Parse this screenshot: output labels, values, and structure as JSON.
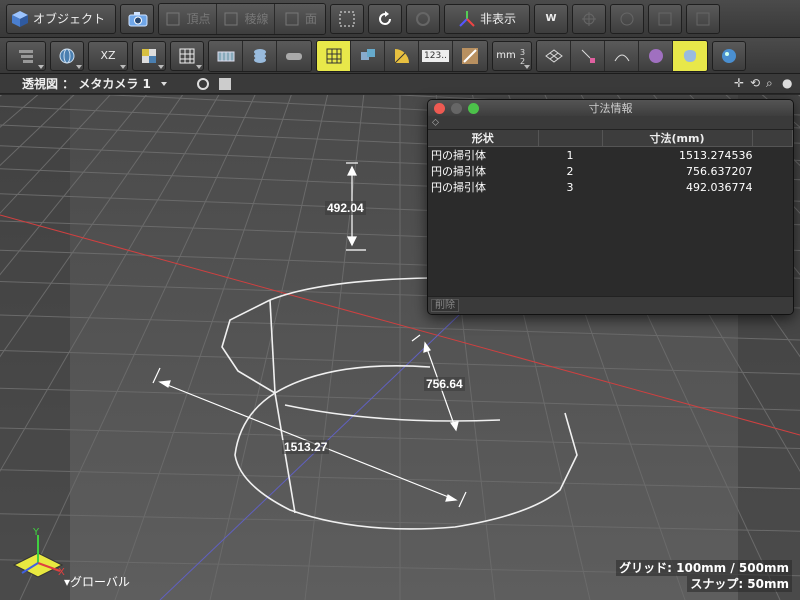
{
  "toolbar1": {
    "object_label": "オブジェクト",
    "vertex_label": "頂点",
    "edge_label": "稜線",
    "face_label": "面",
    "hide_label": "非表示",
    "world_label": "W"
  },
  "toolbar2": {
    "plane_label": "XZ",
    "numeric_label": "123..",
    "unit_label": "mm"
  },
  "viewport": {
    "title": "透視図 ： メタカメラ 1",
    "dimensions": [
      {
        "name": "dim-height",
        "text": "492.04"
      },
      {
        "name": "dim-radius",
        "text": "756.64"
      },
      {
        "name": "dim-diameter",
        "text": "1513.27"
      }
    ],
    "status": {
      "grid": "グリッド: 100mm / 500mm",
      "snap": "スナップ: 50mm"
    },
    "coord_mode": "グローバル",
    "axis_y": "Y",
    "axis_x": "X"
  },
  "dialog": {
    "title": "寸法情報",
    "columns": [
      "形状",
      "",
      "寸法(mm)",
      ""
    ],
    "rows": [
      {
        "shape": "円の掃引体",
        "id": "1",
        "value": "1513.274536"
      },
      {
        "shape": "円の掃引体",
        "id": "2",
        "value": "756.637207"
      },
      {
        "shape": "円の掃引体",
        "id": "3",
        "value": "492.036774"
      }
    ],
    "delete_label": "削除"
  },
  "colors": {
    "x_axis": "#d04040",
    "z_axis": "#6060c0",
    "highlight": "#e8e84a"
  }
}
